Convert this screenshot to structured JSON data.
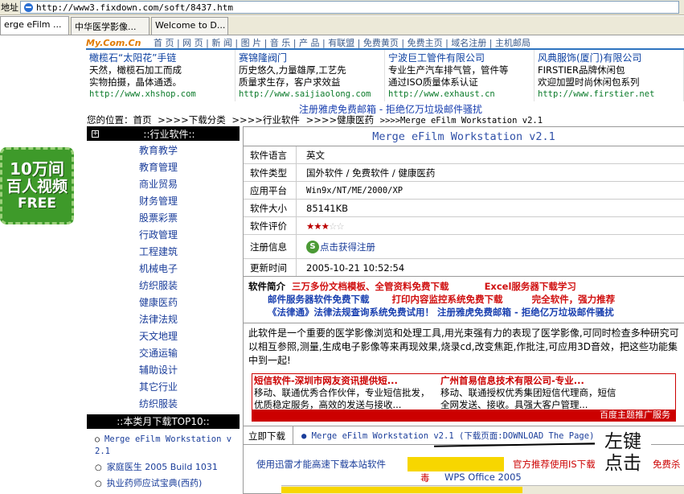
{
  "address_bar": {
    "label": "地址",
    "url": "http://www3.fixdown.com/soft/8437.htm"
  },
  "tabs": [
    "erge eFilm ...",
    "中华医学影像...",
    "Welcome to D..."
  ],
  "top_nav": {
    "logo": "My.Com.Cn",
    "items": [
      "首 页",
      "网 页",
      "新 闻",
      "图 片",
      "音 乐",
      "产 品",
      "有联盟",
      "免费黄页",
      "免费主页",
      "域名注册",
      "主机邮局"
    ]
  },
  "ads": [
    {
      "title": "橄榄石“太阳花”手链",
      "l1": "天然，橄榄石加工而成",
      "l2": "实物拍摄，晶体通透。",
      "url": "http://www.xhshop.com"
    },
    {
      "title": "赛锦隆阀门",
      "l1": "历史悠久,力量雄厚,工艺先",
      "l2": "质量求生存，客户求效益",
      "url": "http://www.saijiaolong.com"
    },
    {
      "title": "宁波巨工管件有限公司",
      "l1": "专业生产汽车排气管，管件等",
      "l2": "通过ISO质量体系认证",
      "url": "http://www.exhaust.cn"
    },
    {
      "title": "风典服饰(厦门)有限公司",
      "l1": "FIRSTIER品牌休闲包",
      "l2": "欢迎加盟时尚休闲包系列",
      "url": "http://www.firstier.net"
    }
  ],
  "notice": "注册雅虎免费邮箱 - 拒绝亿万垃圾邮件骚扰",
  "breadcrumb": [
    "您的位置：首页",
    ">>>>下载分类",
    ">>>>行业软件",
    ">>>>健康医药",
    ">>>>Merge eFilm Workstation v2.1"
  ],
  "sidebar": {
    "heading": "::行业软件::",
    "items": [
      "教育教学",
      "教育管理",
      "商业贸易",
      "财务管理",
      "股票彩票",
      "行政管理",
      "工程建筑",
      "机械电子",
      "纺织服装",
      "健康医药",
      "法律法规",
      "天文地理",
      "交通运输",
      "辅助设计",
      "其它行业",
      "纺织服装"
    ],
    "top10_heading": "::本类月下载TOP10::",
    "top10": [
      "Merge eFilm Workstation v 2.1",
      "家庭医生 2005 Build 1031",
      "执业药师应试宝典(西药)"
    ]
  },
  "left_ad": {
    "l1": "10万间",
    "l2": "百人视频",
    "l3": "FREE"
  },
  "software": {
    "title": "Merge eFilm Workstation v2.1",
    "rows": {
      "lang_k": "软件语言",
      "lang_v": "英文",
      "type_k": "软件类型",
      "type_v": "国外软件 / 免费软件 / 健康医药",
      "plat_k": "应用平台",
      "plat_v": "Win9x/NT/ME/2000/XP",
      "size_k": "软件大小",
      "size_v": "85141KB",
      "rate_k": "软件评价",
      "rate_stars": 3,
      "rate_max": 5,
      "reg_k": "注册信息",
      "reg_v": "点击获得注册",
      "upd_k": "更新时间",
      "upd_v": "2005-10-21 10:52:54"
    },
    "promo": {
      "label": "软件简介",
      "a": "三万多份文档模板、全管资料免费下载",
      "b": "Excel服务器下载学习",
      "c": "邮件服务器软件免费下载",
      "d": "打印内容监控系统免费下载",
      "e": "完全软件，强力推荐",
      "f": "《法律通》法律法规查询系统免费试用！ 注册雅虎免费邮箱 - 拒绝亿万垃圾邮件骚扰"
    },
    "desc": [
      "此软件是一个重要的医学影像浏览和处理工具,用光束强有力的表现了医学影像,可同时检查多种研究可",
      "以相互参照,测量,生成电子影像等来再现效果,烧录cd,改变焦距,作批注,可应用3D音效，把这些功能集",
      "中到一起!"
    ],
    "adbox": {
      "h1": "短信软件-深圳市网友资讯提供短...",
      "t1": "移动、联通优秀合作伙伴，专业短信批发，",
      "t2": "优质稳定服务，高效的发送与接收...",
      "h2": "广州首易信息技术有限公司-专业...",
      "t3": "移动、联通授权优秀集团短信代理商，短信",
      "t4": "全网发送、接收。具强大客户管理...",
      "foot": "百度主题推广服务"
    },
    "download": {
      "label": "立即下载",
      "link": "● Merge eFilm Workstation v2.1 (下载页面:DOWNLOAD The Page)"
    },
    "bottom": {
      "l1": "使用迅雷才能高速下载本站软件",
      "l2": "官方推荐使用IS下载",
      "l3": "免费杀",
      "l4": "毒",
      "l5": "WPS Office 2005"
    }
  },
  "overlay": {
    "line1": "左键",
    "line2": "点击"
  }
}
